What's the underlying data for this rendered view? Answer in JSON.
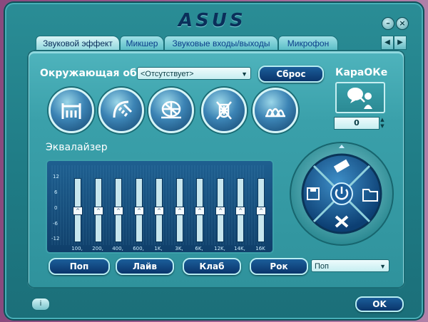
{
  "window": {
    "logo": "ASUS",
    "minimize_label": "–",
    "close_label": "×"
  },
  "tabs": [
    {
      "label": "Звуковой эффект",
      "active": true
    },
    {
      "label": "Микшер",
      "active": false
    },
    {
      "label": "Звуковые входы/выходы",
      "active": false
    },
    {
      "label": "Микрофон",
      "active": false
    }
  ],
  "tab_nav": {
    "prev": "◀",
    "next": "▶"
  },
  "environment": {
    "label": "Окружающая обст",
    "selected": "<Отсутствует>",
    "reset_label": "Сброс",
    "presets": [
      "bathroom-icon",
      "shower-icon",
      "stadium-icon",
      "castle-icon",
      "opera-house-icon"
    ]
  },
  "karaoke": {
    "label": "КараОКе",
    "value": "0",
    "icon": "karaoke-singer-icon"
  },
  "equalizer": {
    "label": "Эквалайзер",
    "scale": [
      "12",
      "6",
      "0",
      "-6",
      "-12"
    ],
    "bands": [
      {
        "freq": "100,",
        "level": 0
      },
      {
        "freq": "200,",
        "level": 0
      },
      {
        "freq": "400,",
        "level": 0
      },
      {
        "freq": "600,",
        "level": 0
      },
      {
        "freq": "1K,",
        "level": 0
      },
      {
        "freq": "3K,",
        "level": 0
      },
      {
        "freq": "6K,",
        "level": 0
      },
      {
        "freq": "12K,",
        "level": 0
      },
      {
        "freq": "14K,",
        "level": 0
      },
      {
        "freq": "16K",
        "level": 0
      }
    ],
    "presets": [
      "Поп",
      "Лайв",
      "Клаб",
      "Рок"
    ],
    "selected_preset": "Поп"
  },
  "dial": {
    "top": "eraser-icon",
    "left": "save-icon",
    "right": "folder-icon",
    "center": "power-icon",
    "bottom": "delete-icon"
  },
  "footer": {
    "info_label": "i",
    "ok_label": "OK"
  },
  "colors": {
    "frame": "#1f7b85",
    "panel": "#3aa0aa",
    "button": "#0a356b",
    "eq_bg": "#0f3f6a"
  }
}
